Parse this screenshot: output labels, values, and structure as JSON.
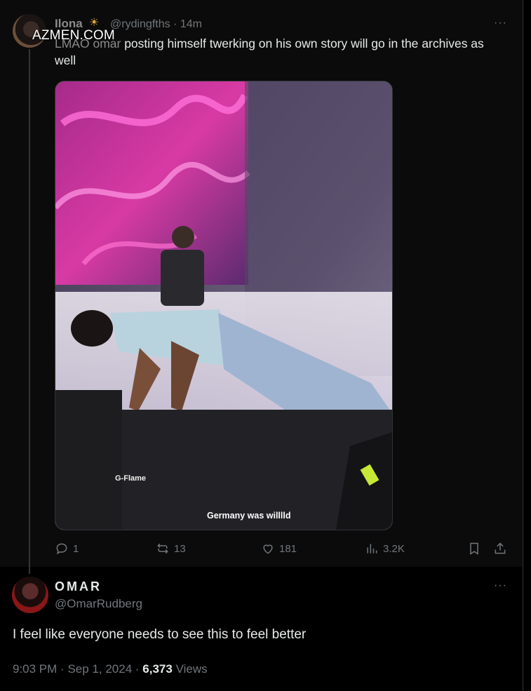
{
  "tweet1": {
    "display_name": "Ilona",
    "name_emoji": "☀",
    "handle": "@rydingfths",
    "separator": "·",
    "time": "14m",
    "watermark": "AZMEN.COM",
    "text_faded": "LMAO omar",
    "text": " posting himself twerking on his own story will go in the archives as well",
    "more": "···",
    "media": {
      "logo_label": "G-Flame",
      "caption": "Germany was willlld"
    },
    "actions": {
      "replies": "1",
      "reposts": "13",
      "likes": "181",
      "views": "3.2K"
    }
  },
  "tweet2": {
    "display_name": "OMAR",
    "handle": "@OmarRudberg",
    "more": "···",
    "text": "I feel like everyone needs to see this to feel better",
    "time": "9:03 PM",
    "sep1": "·",
    "date": "Sep 1, 2024",
    "sep2": "·",
    "views_count": "6,373",
    "views_label": "Views"
  },
  "colors": {
    "background": "#000000",
    "muted": "#71767b",
    "text": "#e7e9ea"
  }
}
